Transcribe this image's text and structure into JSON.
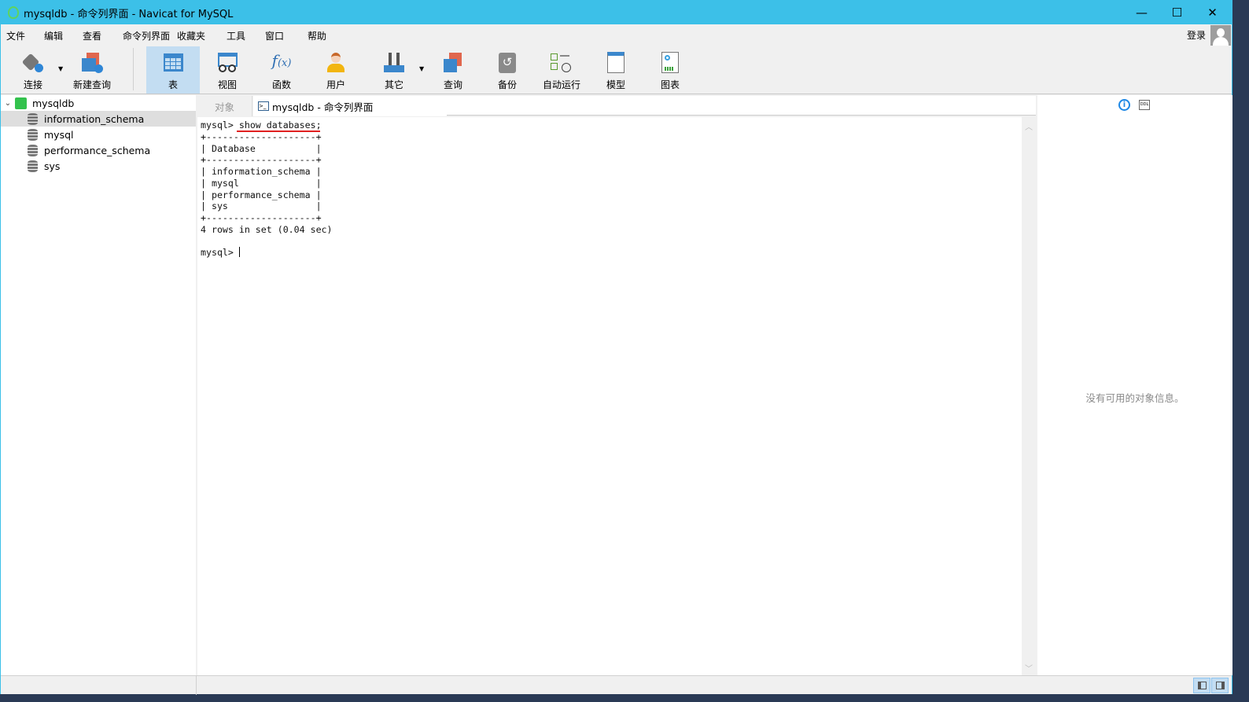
{
  "window": {
    "title": "mysqldb - 命令列界面 - Navicat for MySQL",
    "minimize": "—",
    "maximize": "☐",
    "close": "✕"
  },
  "menu": [
    "文件",
    "编辑",
    "查看",
    "命令列界面",
    "收藏夹",
    "工具",
    "窗口",
    "帮助"
  ],
  "account": {
    "login": "登录"
  },
  "toolbar": [
    {
      "label": "连接",
      "icon": "connection-plug-icon"
    },
    {
      "label": "新建查询",
      "icon": "new-query-icon"
    },
    {
      "label": "表",
      "icon": "table-icon",
      "active": true
    },
    {
      "label": "视图",
      "icon": "view-icon"
    },
    {
      "label": "函数",
      "icon": "function-icon"
    },
    {
      "label": "用户",
      "icon": "user-icon"
    },
    {
      "label": "其它",
      "icon": "tools-icon"
    },
    {
      "label": "查询",
      "icon": "query-icon"
    },
    {
      "label": "备份",
      "icon": "backup-icon"
    },
    {
      "label": "自动运行",
      "icon": "schedule-icon"
    },
    {
      "label": "模型",
      "icon": "model-icon"
    },
    {
      "label": "图表",
      "icon": "chart-icon"
    }
  ],
  "tree": {
    "connection": "mysqldb",
    "databases": [
      "information_schema",
      "mysql",
      "performance_schema",
      "sys"
    ],
    "selected": "information_schema"
  },
  "tabs": {
    "objects": "对象",
    "console": "mysqldb - 命令列界面"
  },
  "console": {
    "lines": [
      "mysql> show databases;",
      "+--------------------+",
      "| Database           |",
      "+--------------------+",
      "| information_schema |",
      "| mysql              |",
      "| performance_schema |",
      "| sys                |",
      "+--------------------+",
      "4 rows in set (0.04 sec)",
      "",
      "mysql> "
    ]
  },
  "info_panel": {
    "empty_message": "没有可用的对象信息。"
  },
  "colors": {
    "titlebar": "#3cc0e8",
    "active_tool": "#c3ddf2",
    "underline": "#e02020"
  }
}
